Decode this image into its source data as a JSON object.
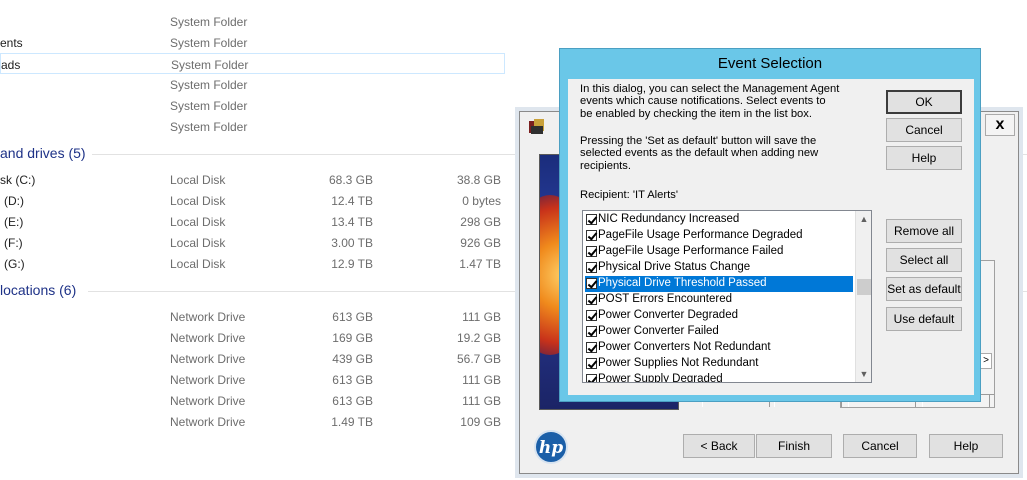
{
  "explorer": {
    "folders": [
      {
        "name": "",
        "type": "System Folder"
      },
      {
        "name": "ents",
        "type": "System Folder"
      },
      {
        "name": "ads",
        "type": "System Folder"
      },
      {
        "name": "",
        "type": "System Folder"
      },
      {
        "name": "",
        "type": "System Folder"
      },
      {
        "name": "",
        "type": "System Folder"
      }
    ],
    "drives_group": "and drives (5)",
    "drives": [
      {
        "name": "sk (C:)",
        "type": "Local Disk",
        "total": "68.3 GB",
        "free": "38.8 GB"
      },
      {
        "name": "(D:)",
        "type": "Local Disk",
        "total": "12.4 TB",
        "free": "0 bytes"
      },
      {
        "name": "(E:)",
        "type": "Local Disk",
        "total": "13.4 TB",
        "free": "298 GB"
      },
      {
        "name": "(F:)",
        "type": "Local Disk",
        "total": "3.00 TB",
        "free": "926 GB"
      },
      {
        "name": "(G:)",
        "type": "Local Disk",
        "total": "12.9 TB",
        "free": "1.47 TB"
      }
    ],
    "network_group": "locations (6)",
    "network": [
      {
        "type": "Network Drive",
        "total": "613 GB",
        "free": "111 GB"
      },
      {
        "type": "Network Drive",
        "total": "169 GB",
        "free": "19.2 GB"
      },
      {
        "type": "Network Drive",
        "total": "439 GB",
        "free": "56.7 GB"
      },
      {
        "type": "Network Drive",
        "total": "613 GB",
        "free": "111 GB"
      },
      {
        "type": "Network Drive",
        "total": "613 GB",
        "free": "111 GB"
      },
      {
        "type": "Network Drive",
        "total": "1.49 TB",
        "free": "109 GB"
      }
    ]
  },
  "wizard": {
    "close_label": "x",
    "logo_text": "hp",
    "back_label": "< Back",
    "finish_label": "Finish",
    "cancel_label": "Cancel",
    "help_label": "Help",
    "scroll_arrow": ">"
  },
  "dialog": {
    "title": "Event Selection",
    "intro": "In this dialog, you can select the Management Agent events which cause notifications. Select events to be enabled by checking the item in the list box.",
    "default_note": "Pressing the 'Set as default' button will save the selected events as the default when adding new recipients.",
    "recipient": "Recipient: 'IT Alerts'",
    "ok_label": "OK",
    "cancel_label": "Cancel",
    "help_label": "Help",
    "remove_all_label": "Remove all",
    "select_all_label": "Select all",
    "set_default_label": "Set as default",
    "use_default_label": "Use default",
    "events": [
      {
        "label": "NIC Redundancy Increased",
        "checked": true
      },
      {
        "label": "PageFile Usage Performance Degraded",
        "checked": true
      },
      {
        "label": "PageFile Usage Performance Failed",
        "checked": true
      },
      {
        "label": "Physical Drive Status Change",
        "checked": true
      },
      {
        "label": "Physical Drive Threshold Passed",
        "checked": true,
        "selected": true
      },
      {
        "label": "POST Errors Encountered",
        "checked": true
      },
      {
        "label": "Power Converter Degraded",
        "checked": true
      },
      {
        "label": "Power Converter Failed",
        "checked": true
      },
      {
        "label": "Power Converters Not Redundant",
        "checked": true
      },
      {
        "label": "Power Supplies Not Redundant",
        "checked": true
      },
      {
        "label": "Power Supply Degraded",
        "checked": true
      }
    ],
    "scroll_up": "▲",
    "scroll_down": "▼"
  },
  "colors": {
    "dialog_frame": "#6ac7e8",
    "selection": "#0078d7",
    "group_header": "#1e3287"
  }
}
